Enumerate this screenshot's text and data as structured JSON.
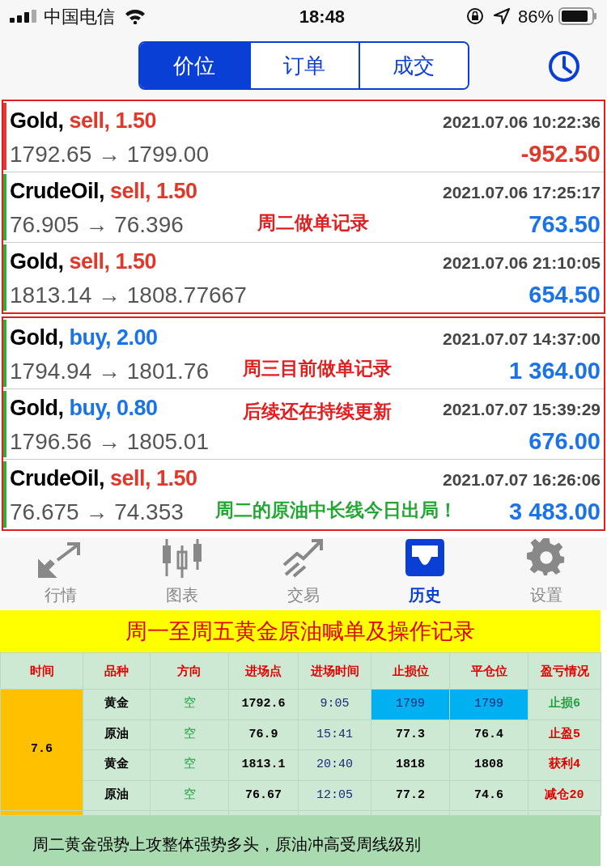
{
  "status_bar": {
    "carrier": "中国电信",
    "time": "18:48",
    "battery": "86%"
  },
  "tabs": [
    {
      "label": "价位",
      "selected": true
    },
    {
      "label": "订单",
      "selected": false
    },
    {
      "label": "成交",
      "selected": false
    }
  ],
  "groups": [
    {
      "trades": [
        {
          "symbol": "Gold,",
          "side": "sell, 1.50",
          "kind": "sell",
          "time": "2021.07.06 10:22:36",
          "prices": "1792.65 → 1799.00",
          "profit": "-952.50",
          "loss": true
        },
        {
          "symbol": "CrudeOil,",
          "side": "sell, 1.50",
          "kind": "sell",
          "time": "2021.07.06 17:25:17",
          "prices": "76.905 → 76.396",
          "profit": "763.50",
          "loss": false,
          "notes": [
            {
              "text": "周二做单记录",
              "kind": "lower",
              "color": "#e02020"
            }
          ]
        },
        {
          "symbol": "Gold,",
          "side": "sell, 1.50",
          "kind": "sell",
          "time": "2021.07.06 21:10:05",
          "prices": "1813.14 → 1808.77667",
          "profit": "654.50",
          "loss": false
        }
      ]
    },
    {
      "trades": [
        {
          "symbol": "Gold,",
          "side": "buy, 2.00",
          "kind": "buy",
          "time": "2021.07.07 14:37:00",
          "prices": "1794.94 → 1801.76",
          "profit": "1 364.00",
          "loss": false,
          "notes": [
            {
              "text": "周三目前做单记录",
              "kind": "lower",
              "color": "#e02020"
            }
          ]
        },
        {
          "symbol": "Gold,",
          "side": "buy, 0.80",
          "kind": "buy",
          "time": "2021.07.07 15:39:29",
          "prices": "1796.56 → 1805.01",
          "profit": "676.00",
          "loss": false,
          "notes": [
            {
              "text": "后续还在持续更新",
              "kind": "upper",
              "color": "#e02020"
            }
          ]
        },
        {
          "symbol": "CrudeOil,",
          "side": "sell, 1.50",
          "kind": "sell",
          "time": "2021.07.07 16:26:06",
          "prices": "76.675 → 74.353",
          "profit": "3 483.00",
          "loss": false,
          "notes": [
            {
              "text": "周二的原油中长线今日出局！",
              "kind": "lower",
              "color": "#22a832"
            }
          ]
        }
      ]
    }
  ],
  "nav": [
    {
      "label": "行情",
      "kind": "quotes",
      "selected": false
    },
    {
      "label": "图表",
      "kind": "chart",
      "selected": false
    },
    {
      "label": "交易",
      "kind": "trade",
      "selected": false
    },
    {
      "label": "历史",
      "kind": "history",
      "selected": true
    },
    {
      "label": "设置",
      "kind": "settings",
      "selected": false
    }
  ],
  "banner": "周一至周五黄金原油喊单及操作记录",
  "table": {
    "columns": [
      "时间",
      "品种",
      "方向",
      "进场点",
      "进场时间",
      "止损位",
      "平仓位",
      "盈亏情况"
    ],
    "rows": [
      {
        "cells": [
          {
            "text": "7.6",
            "rowspan": 4
          },
          "黄金",
          "空",
          "1792.6",
          "9:05",
          "1799",
          "1799",
          "止损6"
        ],
        "highlighted": true,
        "loss": true
      },
      {
        "cells": [
          "原油",
          "空",
          "76.9",
          "15:41",
          "77.3",
          "76.4",
          "止盈5"
        ],
        "highlighted": false,
        "loss": false
      },
      {
        "cells": [
          "黄金",
          "空",
          "1813.1",
          "20:40",
          "1818",
          "1808",
          "获利4"
        ],
        "highlighted": false,
        "loss": false
      },
      {
        "cells": [
          "原油",
          "空",
          "76.67",
          "12:05",
          "77.2",
          "74.6",
          "减仓20"
        ],
        "highlighted": false,
        "loss": false
      }
    ]
  },
  "footer": "周二黄金强势上攻整体强势多头，原油冲高受周线级别"
}
